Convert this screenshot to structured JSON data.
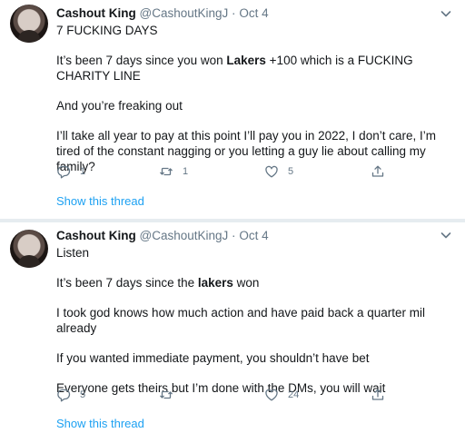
{
  "tweets": [
    {
      "name": "Cashout King",
      "handle": "@CashoutKingJ",
      "separator": "·",
      "date": "Oct 4",
      "paragraphs": [
        [
          "7 FUCKING DAYS"
        ],
        [
          "It’s been 7 days since you won ",
          "Lakers",
          " +100 which is a FUCKING CHARITY LINE"
        ],
        [
          "And you’re freaking out"
        ],
        [
          "I’ll take all year to pay at this point I’ll pay you in 2022, I don’t care, I’m tired of the constant nagging or you letting a guy lie about calling my family?"
        ]
      ],
      "replies": "1",
      "retweets": "1",
      "likes": "5",
      "show_thread": "Show this thread"
    },
    {
      "name": "Cashout King",
      "handle": "@CashoutKingJ",
      "separator": "·",
      "date": "Oct 4",
      "paragraphs": [
        [
          "Listen"
        ],
        [
          "It’s been 7 days since the ",
          "lakers",
          " won"
        ],
        [
          "I took god knows how much action and have paid back a quarter mil already"
        ],
        [
          "If you wanted immediate payment, you shouldn’t have bet"
        ],
        [
          "Everyone gets theirs but I’m done with the DMs, you will wait"
        ]
      ],
      "replies": "5",
      "retweets": "",
      "likes": "24",
      "show_thread": "Show this thread"
    }
  ],
  "colors": {
    "text": "#14171a",
    "secondary": "#657786",
    "link": "#1da1f2",
    "separator": "#e6ecf0"
  },
  "icons": {
    "reply": "reply-icon",
    "retweet": "retweet-icon",
    "like": "like-icon",
    "share": "share-icon",
    "menu": "chevron-down-icon"
  }
}
